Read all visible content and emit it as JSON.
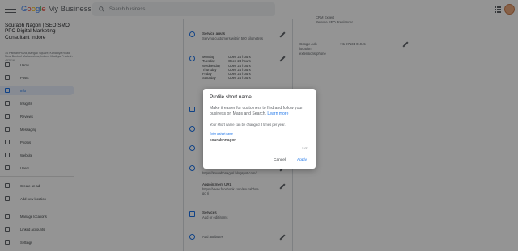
{
  "header": {
    "brand_prefix": [
      "G",
      "o",
      "o",
      "g",
      "l",
      "e"
    ],
    "brand_suffix": "My Business",
    "search_placeholder": "Search business"
  },
  "sidebar": {
    "business_name": "Sourabh Nagori | SEO SMO PPC Digital Marketing Consultant Indore",
    "address": "14 Patwari Plaza, Bangali Square, Kanadiya Road, Near Bank of Maharashtra, Indore, Madhya Pradesh 452016",
    "items": [
      {
        "label": "Home",
        "icon": "home-icon"
      },
      {
        "label": "Posts",
        "icon": "posts-icon"
      },
      {
        "label": "Info",
        "icon": "info-icon",
        "active": true
      },
      {
        "label": "Insights",
        "icon": "insights-icon"
      },
      {
        "label": "Reviews",
        "icon": "reviews-icon"
      },
      {
        "label": "Messaging",
        "icon": "messaging-icon"
      },
      {
        "label": "Photos",
        "icon": "photos-icon"
      },
      {
        "label": "Website",
        "icon": "website-icon"
      },
      {
        "label": "Users",
        "icon": "users-icon"
      },
      {
        "label": "Create an ad",
        "icon": "ad-icon"
      },
      {
        "label": "Add new location",
        "icon": "add-location-icon"
      },
      {
        "label": "Manage locations",
        "icon": "manage-locations-icon"
      },
      {
        "label": "Linked accounts",
        "icon": "linked-accounts-icon"
      },
      {
        "label": "Settings",
        "icon": "settings-icon"
      }
    ]
  },
  "main": {
    "service_area_title": "Service areas",
    "service_area_value": "Serving customers within 500 kilometres",
    "hours": [
      {
        "day": "Monday",
        "time": "Open 24 hours"
      },
      {
        "day": "Tuesday",
        "time": "Open 24 hours"
      },
      {
        "day": "Wednesday",
        "time": "Open 24 hours"
      },
      {
        "day": "Thursday",
        "time": "Open 24 hours"
      },
      {
        "day": "Friday",
        "time": "Open 24 hours"
      },
      {
        "day": "Saturday",
        "time": "Open 24 hours"
      }
    ],
    "website_value": "https://sourabhnagori.blogspot.com/",
    "appointment_title": "Appointment URL",
    "appointment_value": "https://www.facebook.com/sourabhnago ri",
    "services_title": "Services",
    "services_value": "Add or edit items",
    "attributes_label": "Add attributes"
  },
  "right": {
    "top1": "CRM Expert",
    "top2": "Remote SEO Freelancer",
    "voice_label_1": "Google Ads",
    "voice_label_2": "location",
    "voice_label_3": "extensions phone",
    "phone": "+91 97131 01945"
  },
  "dialog": {
    "title": "Profile short name",
    "desc": "Make it easier for customers to find and follow your business on Maps and Search.",
    "learn_more": "Learn more",
    "note": "Your short name can be changed 3 times per year.",
    "field_label": "Enter a short name",
    "field_value": "sourabhnagori",
    "counter": "13/32",
    "cancel": "Cancel",
    "apply": "Apply"
  }
}
